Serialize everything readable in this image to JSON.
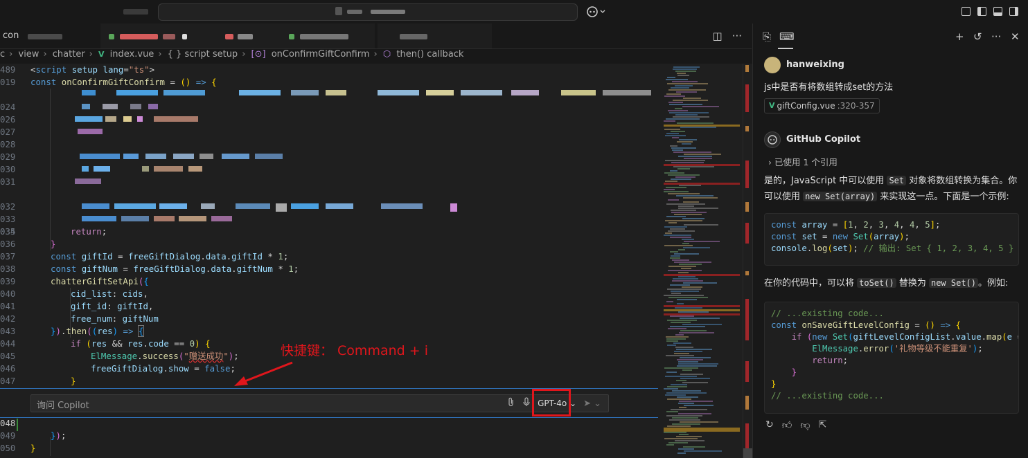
{
  "titlebar": {
    "icons": [
      "copilot-icon",
      "chevron-down-icon",
      "panel-layout-icon",
      "sidebar-left-icon",
      "panel-bottom-icon",
      "sidebar-right-icon"
    ]
  },
  "tabs": {
    "first_tab_label": "con"
  },
  "breadcrumb": {
    "items": [
      "c",
      "view",
      "chatter",
      "index.vue",
      "{ } script setup",
      "onConfirmGiftConfirm",
      "then() callback"
    ]
  },
  "code": {
    "line_489": "489",
    "line_019": "019",
    "line_024": "024",
    "line_026": "026",
    "line_027": "027",
    "line_028": "028",
    "line_029": "029",
    "line_030": "030",
    "line_031": "031",
    "line_032": "032",
    "line_033": "033",
    "line_034": "034",
    "line_035": "035",
    "line_036": "036",
    "line_037": "037",
    "line_038": "038",
    "line_039": "039",
    "line_040": "040",
    "line_041": "041",
    "line_042": "042",
    "line_043": "043",
    "line_044": "044",
    "line_045": "045",
    "line_046": "046",
    "line_047": "047",
    "line_048": "048",
    "line_049": "049",
    "line_050": "050"
  },
  "inline_chat": {
    "placeholder": "询问 Copilot",
    "model": "GPT-4o"
  },
  "annotation": {
    "text": "快捷键： Command + i"
  },
  "chat": {
    "user": {
      "name": "hanweixing",
      "question": "js中是否有将数组转成set的方法",
      "ref_file": "giftConfig.vue",
      "ref_range": ":320-357"
    },
    "assistant": {
      "name": "GitHub Copilot",
      "used_refs": "已使用 1 个引用",
      "p1_a": "是的，JavaScript 中可以使用 ",
      "p1_code1": "Set",
      "p1_b": " 对象将数组转换为集合。你可以使用 ",
      "p1_code2": "new Set(array)",
      "p1_c": " 来实现这一点。下面是一个示例:",
      "p2_a": "在你的代码中，可以将 ",
      "p2_code1": "toSet()",
      "p2_b": " 替换为 ",
      "p2_code2": "new Set()",
      "p2_c": "。例如:"
    }
  },
  "colors": {
    "accent": "#2f6fb6",
    "annotation_red": "#e0161c",
    "vue_green": "#41b883"
  }
}
